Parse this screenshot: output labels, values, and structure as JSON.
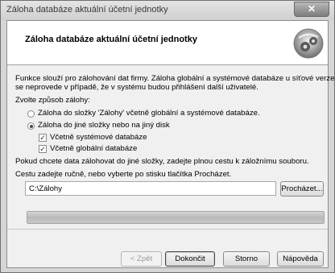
{
  "window": {
    "title": "Záloha databáze aktuální účetní jednotky",
    "close_label": "✕"
  },
  "header": {
    "title": "Záloha databáze aktuální účetní jednotky",
    "icon": "backup-gears-icon"
  },
  "intro_text_line1": "Funkce slouží pro zálohování dat firmy. Záloha globální a systémové databáze u síťové verze",
  "intro_text_line2": "se neprovede v případě, že v systému budou přihlášení další uživatelé.",
  "choose_label": "Zvolte způsob zálohy:",
  "options": {
    "radio1_label": "Záloha do složky 'Zálohy' včetně globální a systémové databáze.",
    "radio1_selected": false,
    "radio2_label": "Záloha do jiné složky nebo na jiný disk",
    "radio2_selected": true,
    "check_system_label": "Včetně systémové databáze",
    "check_system_checked": true,
    "check_global_label": "Včetně globální databáze",
    "check_global_checked": true
  },
  "hint1": "Pokud chcete data zálohovat do jiné složky, zadejte plnou cestu k záložnímu souboru.",
  "hint2": "Cestu zadejte ručně, nebo vyberte po stisku tlačítka Procházet.",
  "path_value": "C:\\Zálohy",
  "browse_label": "Procházet...",
  "progress_fraction": 1.0,
  "buttons": {
    "back": "< Zpět",
    "finish": "Dokončit",
    "cancel": "Storno",
    "help": "Nápověda"
  }
}
